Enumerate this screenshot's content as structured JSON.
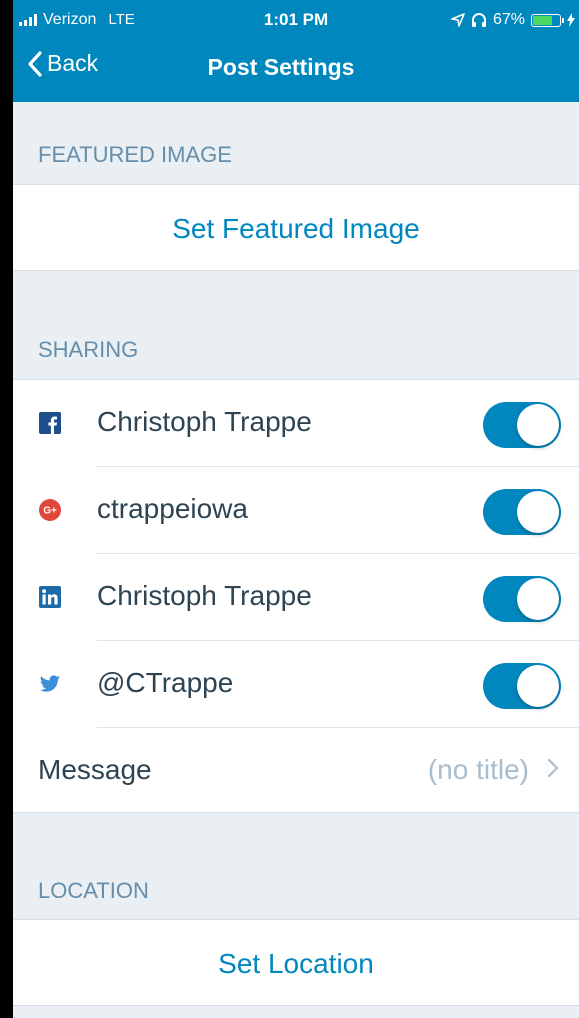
{
  "status_bar": {
    "carrier": "Verizon",
    "network": "LTE",
    "time": "1:01 PM",
    "battery_percent": "67%",
    "battery_level": 0.67
  },
  "nav": {
    "back_label": "Back",
    "title": "Post Settings"
  },
  "featured_image": {
    "header": "FEATURED IMAGE",
    "action": "Set Featured Image"
  },
  "sharing": {
    "header": "SHARING",
    "items": [
      {
        "service": "facebook",
        "icon": "facebook-icon",
        "label": "Christoph Trappe",
        "enabled": true
      },
      {
        "service": "google-plus",
        "icon": "google-plus-icon",
        "label": "ctrappeiowa",
        "enabled": true
      },
      {
        "service": "linkedin",
        "icon": "linkedin-icon",
        "label": "Christoph Trappe",
        "enabled": true
      },
      {
        "service": "twitter",
        "icon": "twitter-icon",
        "label": "@CTrappe",
        "enabled": true
      }
    ],
    "message_label": "Message",
    "message_value": "(no title)"
  },
  "location": {
    "header": "LOCATION",
    "action": "Set Location"
  },
  "colors": {
    "accent": "#0087be",
    "background": "#e9eff3",
    "section_header": "#668eaa"
  }
}
